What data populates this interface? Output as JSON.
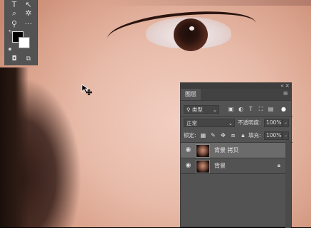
{
  "toolbox": {
    "tools": [
      "move-tool",
      "lasso-tool",
      "magic-wand-tool",
      "brush-tool",
      "zoom-tool",
      "more-tools"
    ],
    "foreground_color": "#000000",
    "background_color": "#ffffff"
  },
  "layers_panel": {
    "tab_label": "图层",
    "filter_label": "类型",
    "blend_mode": "正常",
    "opacity_label": "不透明度:",
    "opacity_value": "100%",
    "lock_label": "锁定:",
    "fill_label": "填充:",
    "fill_value": "100%",
    "layers": [
      {
        "name": "背景 拷贝",
        "selected": true,
        "visible": true,
        "locked": false
      },
      {
        "name": "背景",
        "selected": false,
        "visible": true,
        "locked": true
      }
    ]
  },
  "colors": {
    "panel_bg": "#535353",
    "panel_dark": "#3d3d3d",
    "selected_row": "#6b6b6b"
  }
}
